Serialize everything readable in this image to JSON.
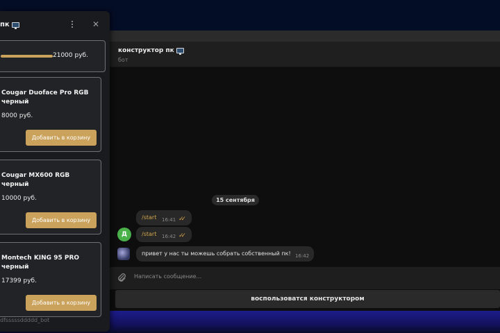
{
  "chat": {
    "title": "конструктор пк",
    "status": "бот",
    "date_separator": "15 сентября",
    "messages": [
      {
        "text": "/start",
        "time": "16:41",
        "direction": "out",
        "ticks": "✓✓"
      },
      {
        "text": "/start",
        "time": "16:42",
        "direction": "out",
        "ticks": "✓✓"
      },
      {
        "text": "привет у нас ты можешь собрать собственный пк!",
        "time": "16:42",
        "direction": "in"
      }
    ],
    "avatar_letter": "Д",
    "input_placeholder": "Написать сообщение...",
    "keyboard_button": "воспользоватся конструктором"
  },
  "miniapp": {
    "title_fragment": "пк",
    "budget_value": "21000 руб.",
    "products": [
      {
        "name": "Cougar Duoface Pro RGB черный",
        "price": "8000 руб.",
        "button": "Добавить в корзину"
      },
      {
        "name": "Cougar MX600 RGB черный",
        "price": "10000 руб.",
        "button": "Добавить в корзину"
      },
      {
        "name": "Montech KING 95 PRO черный",
        "price": "17399 руб.",
        "button": "Добавить в корзину"
      }
    ],
    "footer_bot": "dfsssssddddd_bot"
  },
  "colors": {
    "accent": "#caa25b",
    "avatar": "#4ab04a",
    "out_text": "#d2a74b"
  }
}
